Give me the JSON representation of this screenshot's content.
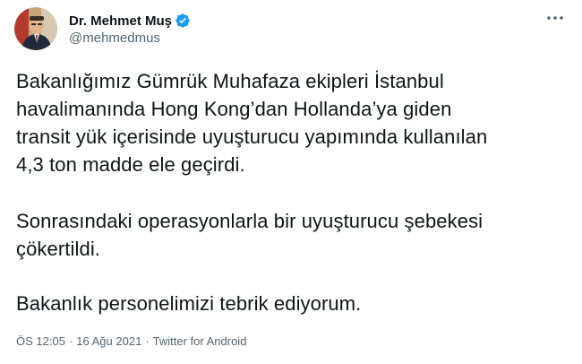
{
  "author": {
    "display_name": "Dr. Mehmet Muş",
    "handle": "@mehmedmus",
    "verified": true,
    "avatar_icon": "profile-photo"
  },
  "tweet": {
    "paragraphs": [
      "Bakanlığımız Gümrük Muhafaza ekipleri İstanbul\nhavalimanında Hong Kong’dan Hollanda’ya giden\ntransit yük içerisinde uyuşturucu yapımında kullanılan\n4,3 ton madde ele geçirdi.",
      "Sonrasındaki operasyonlarla bir uyuşturucu şebekesi\nçökertildi.",
      "Bakanlık personelimizi tebrik ediyorum."
    ],
    "time": "ÖS 12:05",
    "date": "16 Ağu 2021",
    "source": "Twitter for Android",
    "separator": "·"
  },
  "icons": {
    "more": "more-dots-icon",
    "verified": "verified-badge-icon"
  },
  "colors": {
    "text_primary": "#0f1419",
    "text_secondary": "#536471",
    "verified_blue": "#1d9bf0",
    "background": "#ffffff"
  }
}
